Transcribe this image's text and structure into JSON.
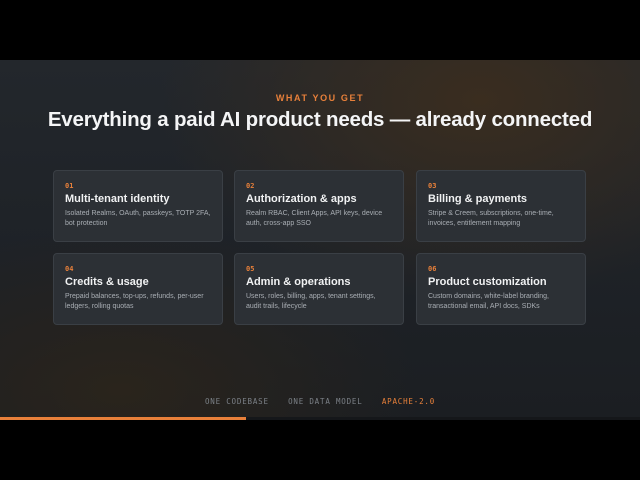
{
  "kicker": "WHAT YOU GET",
  "headline": "Everything a paid AI product needs — already connected",
  "cards": [
    {
      "num": "01",
      "title": "Multi-tenant identity",
      "desc": "Isolated Realms, OAuth, passkeys, TOTP 2FA, bot protection"
    },
    {
      "num": "02",
      "title": "Authorization & apps",
      "desc": "Realm RBAC, Client Apps, API keys, device auth, cross-app SSO"
    },
    {
      "num": "03",
      "title": "Billing & payments",
      "desc": "Stripe & Creem, subscriptions, one-time, invoices, entitlement mapping"
    },
    {
      "num": "04",
      "title": "Credits & usage",
      "desc": "Prepaid balances, top-ups, refunds, per-user ledgers, rolling quotas"
    },
    {
      "num": "05",
      "title": "Admin & operations",
      "desc": "Users, roles, billing, apps, tenant settings, audit trails, lifecycle"
    },
    {
      "num": "06",
      "title": "Product customization",
      "desc": "Custom domains, white-label branding, transactional email, API docs, SDKs"
    }
  ],
  "footer": {
    "item1": "ONE CODEBASE",
    "item2": "ONE DATA MODEL",
    "item3": "APACHE-2.0"
  },
  "progress": 0.385,
  "colors": {
    "accent": "#e8803a",
    "card_bg": "#2c3035",
    "text": "#f4f5f6"
  }
}
